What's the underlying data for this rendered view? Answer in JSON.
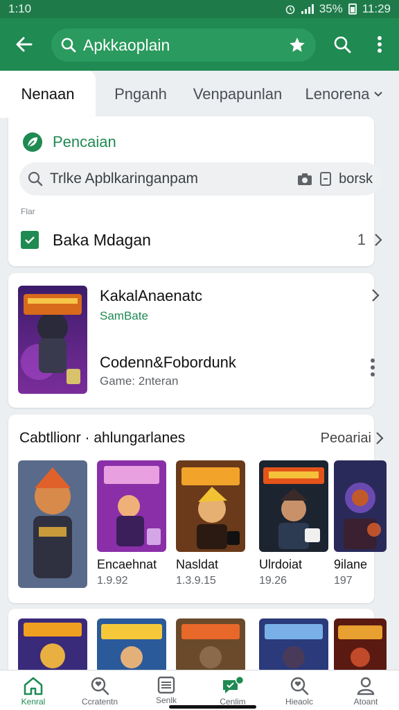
{
  "status_bar": {
    "time": "1:10",
    "battery": "35%",
    "clock": "11:29"
  },
  "app_bar": {
    "search_text": "Apkkaoplain"
  },
  "tabs": [
    {
      "label": "Nenaan",
      "active": true
    },
    {
      "label": "Pnganh",
      "active": false
    },
    {
      "label": "Venpapunlan",
      "active": false
    },
    {
      "label": "Lenorena",
      "active": false
    }
  ],
  "search_card": {
    "title": "Pencaian",
    "query": "Trlke Apblkaringanpam",
    "right_label": "borsk",
    "small_label": "Flar",
    "item": {
      "label": "Baka Mdagan",
      "count": "1"
    }
  },
  "featured": {
    "title": "KakalAnaenatc",
    "subtitle": "SamBate",
    "second_title": "Codenn&Fobordunk",
    "second_subtitle": "Game: 2nteran"
  },
  "games_row": {
    "title": "Cabtllionr · ahlungarlanes",
    "more": "Peoariai",
    "items": [
      {
        "name": "Encaehnat",
        "number": "1.9.92"
      },
      {
        "name": "Nasldat",
        "number": "1.3.9.15"
      },
      {
        "name": "Ulrdoiat",
        "number": "19.26"
      },
      {
        "name": "9ilane",
        "number": "197"
      }
    ]
  },
  "bottom_nav": [
    {
      "label": "Kenral",
      "icon": "home-icon",
      "active": true
    },
    {
      "label": "Ccratentn",
      "icon": "search-heart-icon",
      "active": false
    },
    {
      "label": "Senlk",
      "icon": "list-icon",
      "active": false
    },
    {
      "label": "Cenlim",
      "icon": "chat-badge-icon",
      "active": false
    },
    {
      "label": "Hieaolc",
      "icon": "search-icon",
      "active": false
    },
    {
      "label": "Atoant",
      "icon": "person-icon",
      "active": false
    }
  ],
  "colors": {
    "primary": "#1f8a52",
    "status": "#1f7a4a",
    "background": "#eceff1"
  }
}
